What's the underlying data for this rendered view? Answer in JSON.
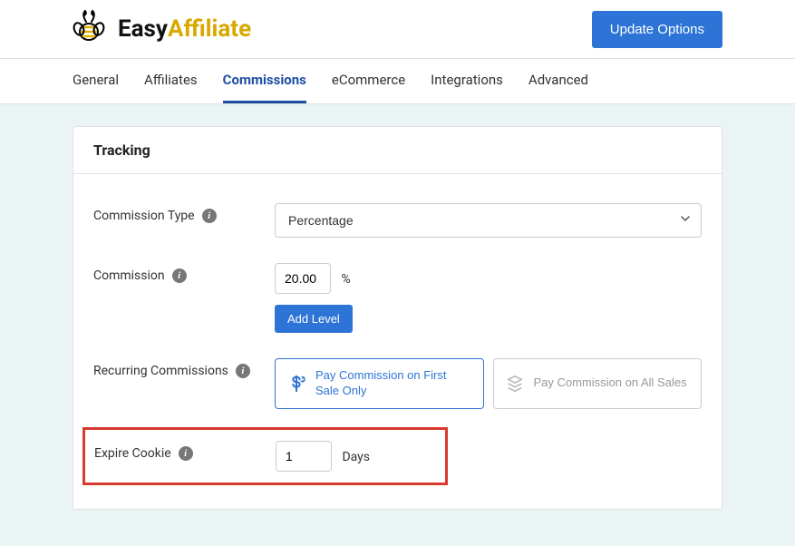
{
  "header": {
    "logo_prefix": "Easy",
    "logo_suffix": "Affiliate",
    "update_button": "Update Options"
  },
  "tabs": [
    {
      "label": "General"
    },
    {
      "label": "Affiliates"
    },
    {
      "label": "Commissions",
      "active": true
    },
    {
      "label": "eCommerce"
    },
    {
      "label": "Integrations"
    },
    {
      "label": "Advanced"
    }
  ],
  "panel": {
    "title": "Tracking",
    "commission_type": {
      "label": "Commission Type",
      "value": "Percentage"
    },
    "commission": {
      "label": "Commission",
      "value": "20.00",
      "unit": "%",
      "add_level": "Add Level"
    },
    "recurring": {
      "label": "Recurring Commissions",
      "option1": "Pay Commission on First Sale Only",
      "option2": "Pay Commission on All Sales"
    },
    "expire_cookie": {
      "label": "Expire Cookie",
      "value": "1",
      "unit": "Days"
    }
  }
}
